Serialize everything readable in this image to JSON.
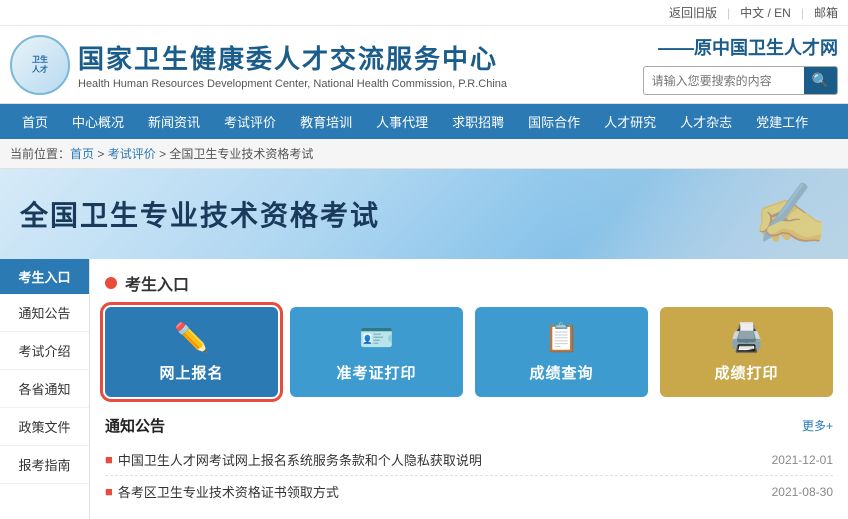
{
  "topbar": {
    "oldVersion": "返回旧版",
    "language": "中文 / EN",
    "mail": "邮箱"
  },
  "header": {
    "logo_alt": "国家卫生健康委人才交流服务中心logo",
    "title_cn": "国家卫生健康委人才交流服务中心",
    "title_en": "Health Human Resources Development Center, National Health Commission, P.R.China",
    "slogan": "——原中国卫生人才网",
    "search_placeholder": "请输入您要搜索的内容"
  },
  "nav": {
    "items": [
      "首页",
      "中心概况",
      "新闻资讯",
      "考试评价",
      "教育培训",
      "人事代理",
      "求职招聘",
      "国际合作",
      "人才研究",
      "人才杂志",
      "党建工作"
    ]
  },
  "breadcrumb": {
    "home": "首页",
    "level1": "考试评价",
    "level2": "全国卫生专业技术资格考试"
  },
  "hero": {
    "title": "全国卫生专业技术资格考试"
  },
  "sidebar": {
    "header": "考生入口",
    "items": [
      "通知公告",
      "考试介绍",
      "各省通知",
      "政策文件",
      "报考指南"
    ]
  },
  "section": {
    "dot_color": "#e74c3c",
    "title": "考生入口"
  },
  "entry_buttons": [
    {
      "id": "online-register",
      "icon": "✏️",
      "label": "网上报名",
      "style": "blue highlighted"
    },
    {
      "id": "admit-card",
      "icon": "🪪",
      "label": "准考证打印",
      "style": "blue-light"
    },
    {
      "id": "score-query",
      "icon": "📋",
      "label": "成绩查询",
      "style": "blue-mid"
    },
    {
      "id": "score-print",
      "icon": "🖨️",
      "label": "成绩打印",
      "style": "gold"
    }
  ],
  "notice": {
    "title": "通知公告",
    "more": "更多+",
    "items": [
      {
        "text": "中国卫生人才网考试网上报名系统服务条款和个人隐私获取说明",
        "date": "2021-12-01"
      },
      {
        "text": "各考区卫生专业技术资格证书领取方式",
        "date": "2021-08-30"
      }
    ]
  }
}
